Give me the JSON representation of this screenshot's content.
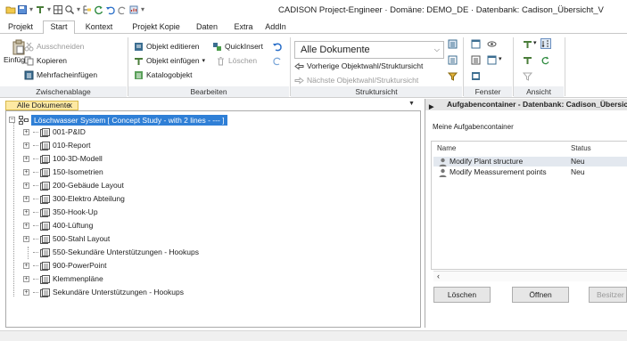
{
  "window": {
    "title": "CADISON Project-Engineer · Domäne: DEMO_DE · Datenbank: Cadison_Übersicht_V"
  },
  "ribbon_tabs": [
    "Projekt",
    "Start",
    "Kontext",
    "Projekt Kopie",
    "Daten",
    "Extra",
    "AddIn"
  ],
  "active_tab": "Start",
  "ribbon": {
    "zwischenablage": {
      "label": "Zwischenablage",
      "einfuegen": "Einfügen",
      "ausschneiden": "Ausschneiden",
      "kopieren": "Kopieren",
      "mehrfacheinfuegen": "Mehrfacheinfügen"
    },
    "bearbeiten": {
      "label": "Bearbeiten",
      "objekt_editieren": "Objekt editieren",
      "quickinsert": "QuickInsert",
      "objekt_einfuegen": "Objekt einfügen",
      "loeschen": "Löschen",
      "katalogobjekt": "Katalogobjekt"
    },
    "struktursicht": {
      "label": "Struktursicht",
      "selected_document": "Alle Dokumente",
      "vorherige": "Vorherige Objektwahl/Struktursicht",
      "naechste": "Nächste Objektwahl/Struktursicht"
    },
    "fenster": {
      "label": "Fenster"
    },
    "ansicht": {
      "label": "Ansicht"
    }
  },
  "doc_tab": {
    "label": "Alle Dokumente",
    "close": "x"
  },
  "tree": {
    "root": "Löschwasser System    [ Concept Study - with 2 lines - --- ]",
    "items": [
      "001-P&ID",
      "010-Report",
      "100-3D-Modell",
      "150-Isometrien",
      "200-Gebäude Layout",
      "300-Elektro Abteilung",
      "350-Hook-Up",
      "400-Lüftung",
      "500-Stahl Layout",
      "550-Sekundäre Unterstützungen - Hookups",
      "900-PowerPoint",
      "Klemmenpläne",
      "Sekundäre Unterstützungen - Hookups"
    ]
  },
  "tasks": {
    "title": "Aufgabencontainer - Datenbank: Cadison_Übersicht_",
    "subtitle": "Meine Aufgabencontainer",
    "columns": [
      "Name",
      "Status"
    ],
    "rows": [
      {
        "name": "Modify Plant structure",
        "status": "Neu"
      },
      {
        "name": "Modify Meassurement points",
        "status": "Neu"
      }
    ],
    "buttons": {
      "loeschen": "Löschen",
      "oeffnen": "Öffnen",
      "besitzer": "Besitzer ä"
    }
  },
  "colors": {
    "selection": "#2f7fd6",
    "doc_tab_bg": "#fde9a3",
    "group_label_bg": "#eef0f3"
  }
}
